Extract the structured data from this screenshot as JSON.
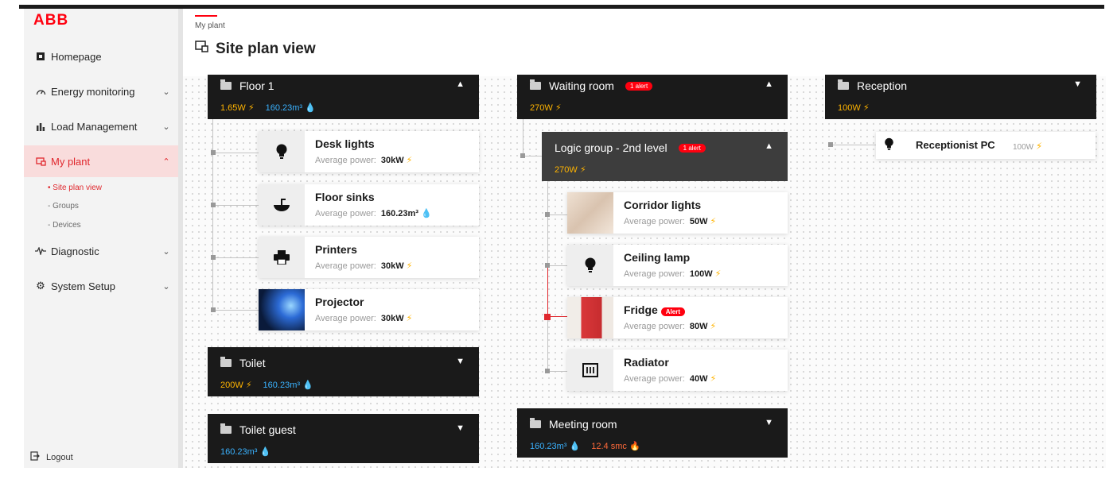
{
  "brand": {
    "logo": "ABB"
  },
  "sidebar": {
    "items": [
      {
        "label": "Homepage",
        "icon": "home-icon"
      },
      {
        "label": "Energy monitoring",
        "icon": "gauge-icon"
      },
      {
        "label": "Load Management",
        "icon": "bar-chart-icon"
      },
      {
        "label": "My plant",
        "icon": "plant-icon"
      },
      {
        "label": "Diagnostic",
        "icon": "pulse-icon"
      },
      {
        "label": "System Setup",
        "icon": "gear-icon"
      }
    ],
    "subitems": [
      "• Site plan view",
      "- Groups",
      "- Devices"
    ],
    "logout": "Logout"
  },
  "header": {
    "breadcrumb": "My plant",
    "title": "Site plan view"
  },
  "columns": {
    "floor1": {
      "name": "Floor 1",
      "power": "1.65W",
      "water": "160.23m³",
      "devices": [
        {
          "name": "Desk lights",
          "label": "Average power:",
          "value": "30kW"
        },
        {
          "name": "Floor sinks",
          "label": "Average power:",
          "value": "160.23m³"
        },
        {
          "name": "Printers",
          "label": "Average power:",
          "value": "30kW"
        },
        {
          "name": "Projector",
          "label": "Average power:",
          "value": "30kW"
        }
      ]
    },
    "toilet": {
      "name": "Toilet",
      "power": "200W",
      "water": "160.23m³"
    },
    "toilet_guest": {
      "name": "Toilet guest",
      "water": "160.23m³"
    },
    "waiting_room": {
      "name": "Waiting room",
      "alert": "1 alert",
      "power": "270W",
      "logic_group": {
        "name": "Logic group - 2nd level",
        "alert": "1 alert",
        "power": "270W"
      },
      "devices": [
        {
          "name": "Corridor lights",
          "label": "Average power:",
          "value": "50W"
        },
        {
          "name": "Ceiling lamp",
          "label": "Average power:",
          "value": "100W"
        },
        {
          "name": "Fridge",
          "alert": "Alert",
          "label": "Average power:",
          "value": "80W"
        },
        {
          "name": "Radiator",
          "label": "Average power:",
          "value": "40W"
        }
      ]
    },
    "meeting_room": {
      "name": "Meeting room",
      "water": "160.23m³",
      "gas": "12.4 smc"
    },
    "reception": {
      "name": "Reception",
      "power": "100W",
      "device": {
        "name": "Receptionist PC",
        "value": "100W"
      }
    }
  },
  "colors": {
    "accent": "#ff000f",
    "power": "#ffb400",
    "water": "#3ab2ff",
    "gas": "#ff6a3a"
  }
}
